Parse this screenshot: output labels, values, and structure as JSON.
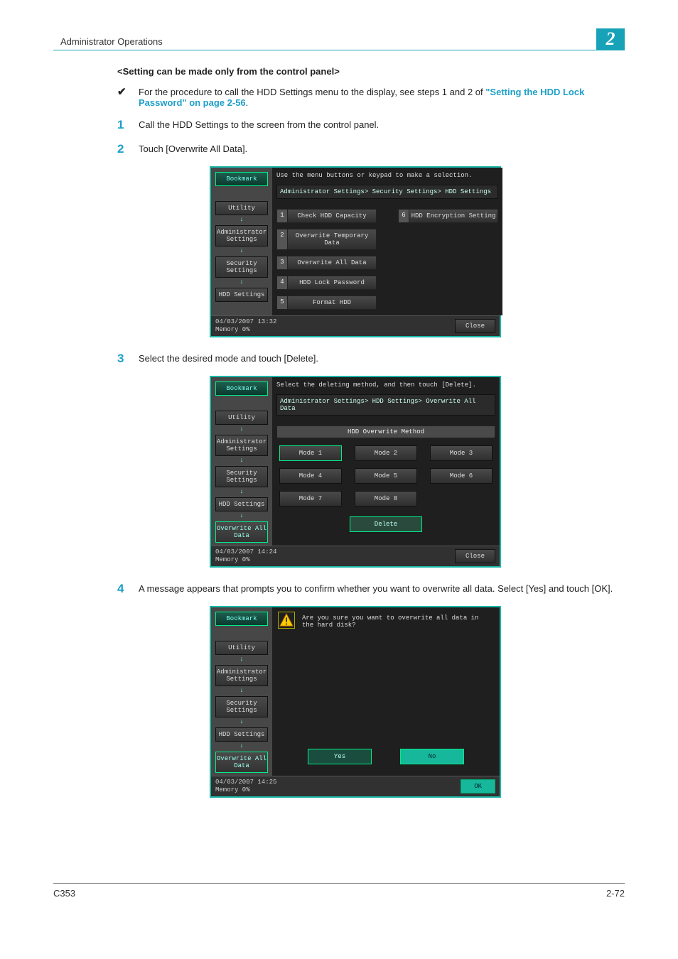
{
  "running_head": {
    "title": "Administrator Operations",
    "chapter": "2"
  },
  "section_title": "<Setting can be made only from the control panel>",
  "note": {
    "pre": "For the procedure to call the HDD Settings menu to the display, see steps 1 and 2 of ",
    "link": "\"Setting the HDD Lock Password\" on page 2-56",
    "post": "."
  },
  "steps": {
    "s1": "Call the HDD Settings to the screen from the control panel.",
    "s2": "Touch [Overwrite All Data].",
    "s3": "Select the desired mode and touch [Delete].",
    "s4": "A message appears that prompts you to confirm whether you want to overwrite all data. Select [Yes] and touch [OK]."
  },
  "panel1": {
    "bookmark": "Bookmark",
    "nav": [
      "Utility",
      "Administrator Settings",
      "Security Settings",
      "HDD Settings"
    ],
    "instr": "Use the menu buttons or keypad to make a selection.",
    "breadcrumb": "Administrator Settings> Security Settings> HDD Settings",
    "options_left": [
      {
        "n": "1",
        "l": "Check HDD Capacity"
      },
      {
        "n": "2",
        "l": "Overwrite Temporary Data"
      },
      {
        "n": "3",
        "l": "Overwrite All Data"
      },
      {
        "n": "4",
        "l": "HDD Lock Password"
      },
      {
        "n": "5",
        "l": "Format HDD"
      }
    ],
    "options_right": [
      {
        "n": "6",
        "l": "HDD Encryption Setting"
      }
    ],
    "datetime": "04/03/2007   13:32",
    "memory": "Memory        0%",
    "close": "Close"
  },
  "panel2": {
    "bookmark": "Bookmark",
    "nav": [
      "Utility",
      "Administrator Settings",
      "Security Settings",
      "HDD Settings",
      "Overwrite All Data"
    ],
    "instr": "Select the deleting method, and then touch [Delete].",
    "breadcrumb": "Administrator Settings> HDD Settings> Overwrite All Data",
    "method_title": "HDD Overwrite Method",
    "modes": [
      "Mode 1",
      "Mode 2",
      "Mode 3",
      "Mode 4",
      "Mode 5",
      "Mode 6",
      "Mode 7",
      "Mode 8"
    ],
    "delete": "Delete",
    "datetime": "04/03/2007   14:24",
    "memory": "Memory        0%",
    "close": "Close"
  },
  "panel3": {
    "bookmark": "Bookmark",
    "nav": [
      "Utility",
      "Administrator Settings",
      "Security Settings",
      "HDD Settings",
      "Overwrite All Data"
    ],
    "warn": "Are you sure you want to overwrite all data in the hard disk?",
    "yes": "Yes",
    "no": "No",
    "datetime": "04/03/2007   14:25",
    "memory": "Memory        0%",
    "ok": "OK"
  },
  "page_footer": {
    "model": "C353",
    "page": "2-72"
  }
}
